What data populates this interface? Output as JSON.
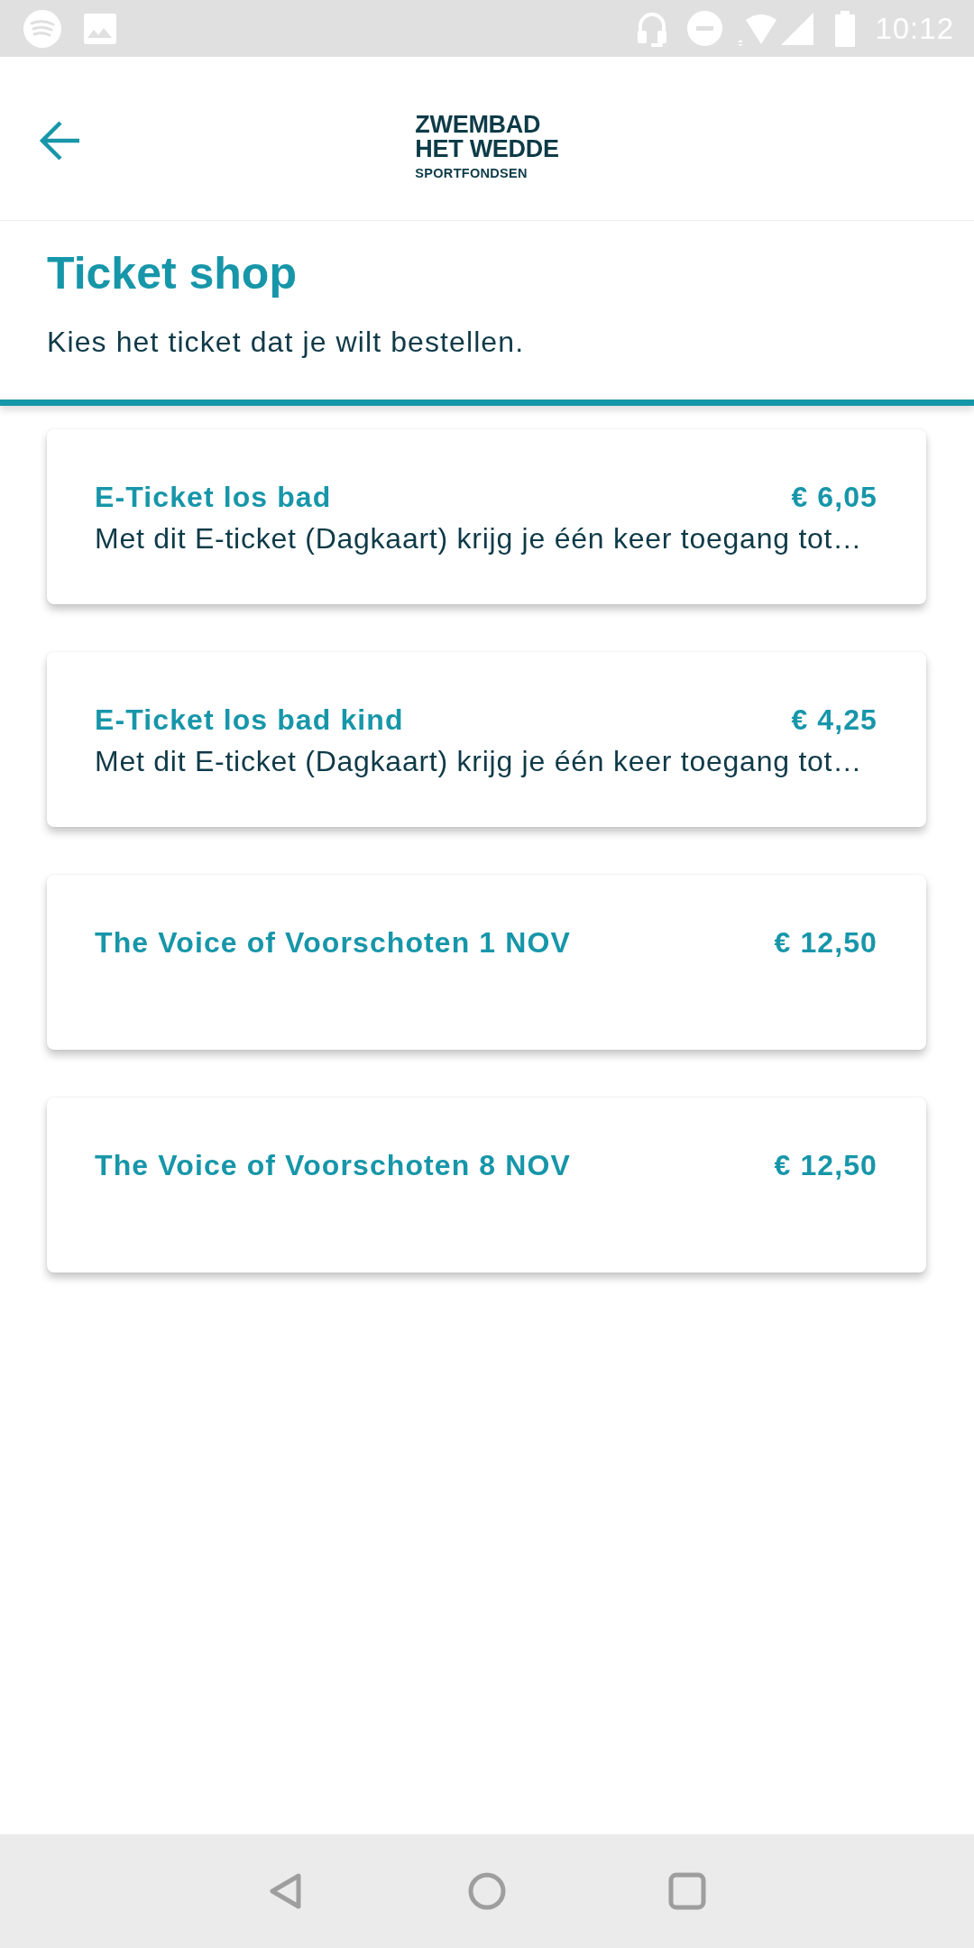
{
  "status_bar": {
    "time": "10:12"
  },
  "header": {
    "logo": {
      "lines": [
        "ZWEMBAD",
        "HET WEDDE"
      ],
      "tagline": "SPORTFONDSEN"
    }
  },
  "page": {
    "title": "Ticket shop",
    "subtitle": "Kies het ticket dat je wilt bestellen."
  },
  "tickets": [
    {
      "name": "E-Ticket los bad",
      "price": "€ 6,05",
      "description": "Met dit E-ticket (Dagkaart) krijg je één keer toegang tot…"
    },
    {
      "name": "E-Ticket los bad kind",
      "price": "€ 4,25",
      "description": "Met dit E-ticket (Dagkaart) krijg je één keer toegang tot…"
    },
    {
      "name": "The Voice of Voorschoten 1 NOV",
      "price": "€ 12,50"
    },
    {
      "name": "The Voice of Voorschoten 8 NOV",
      "price": "€ 12,50"
    }
  ]
}
